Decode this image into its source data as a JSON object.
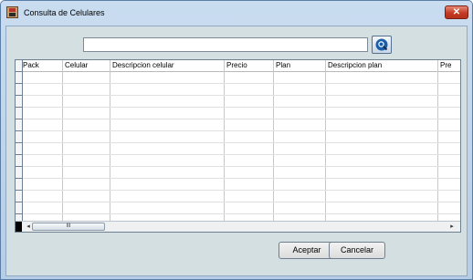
{
  "window": {
    "title": "Consulta de Celulares",
    "close_glyph": "✕"
  },
  "search": {
    "value": "",
    "placeholder": ""
  },
  "grid": {
    "columns": [
      "Pack",
      "Celular",
      "Descripcion celular",
      "Precio",
      "Plan",
      "Descripcion plan",
      "Pre"
    ],
    "rows": []
  },
  "scrollbar": {
    "thumb_label": "III",
    "left_arrow": "◂",
    "right_arrow": "▸"
  },
  "buttons": {
    "accept": "Aceptar",
    "cancel": "Cancelar"
  },
  "icons": {
    "app": "app-icon",
    "search": "magnifier-icon",
    "close": "close-icon"
  }
}
